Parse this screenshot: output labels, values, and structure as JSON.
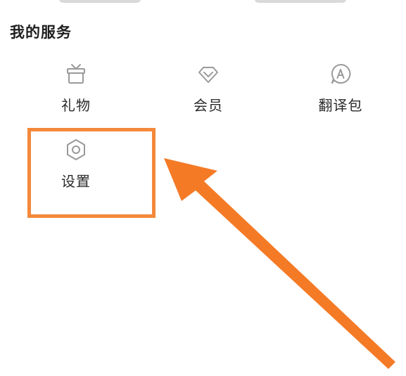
{
  "section": {
    "title": "我的服务"
  },
  "services": {
    "gift": {
      "label": "礼物",
      "icon": "gift-box-icon"
    },
    "vip": {
      "label": "会员",
      "icon": "diamond-icon"
    },
    "translate": {
      "label": "翻译包",
      "icon": "translate-bubble-icon"
    },
    "settings": {
      "label": "设置",
      "icon": "hexagon-gear-icon"
    }
  },
  "annotation": {
    "highlight_color": "#f4883b",
    "arrow_color": "#f47a26",
    "icon_color": "#9a9a9a"
  }
}
